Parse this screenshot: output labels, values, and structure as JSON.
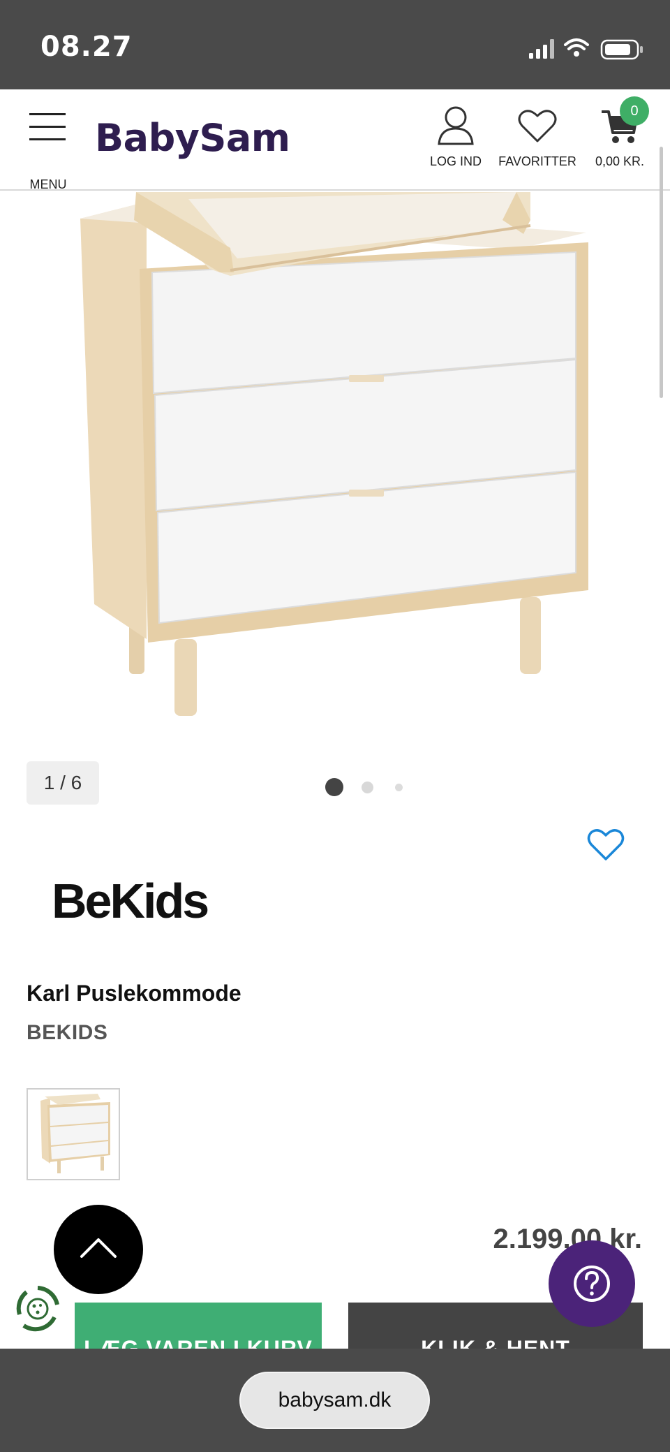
{
  "status_bar": {
    "time": "08.27"
  },
  "header": {
    "menu_label": "MENU",
    "logo": "BabySam",
    "login_label": "LOG IND",
    "favorites_label": "FAVORITTER",
    "cart_total": "0,00 KR.",
    "cart_count": "0"
  },
  "gallery": {
    "counter": "1 / 6",
    "dots": 3,
    "active_dot": 0
  },
  "product": {
    "brand_logo": "BeKids",
    "title": "Karl Puslekommode",
    "brand": "BEKIDS",
    "price": "2.199,00 kr."
  },
  "actions": {
    "add_to_cart": "LÆG VAREN I KURV",
    "click_collect": "KLIK & HENT"
  },
  "browser": {
    "url": "babysam.dk"
  },
  "colors": {
    "brand_purple": "#2e1d4f",
    "accent_green": "#3fae74",
    "help_purple": "#4b2379",
    "favorite_blue": "#1a87d8"
  }
}
